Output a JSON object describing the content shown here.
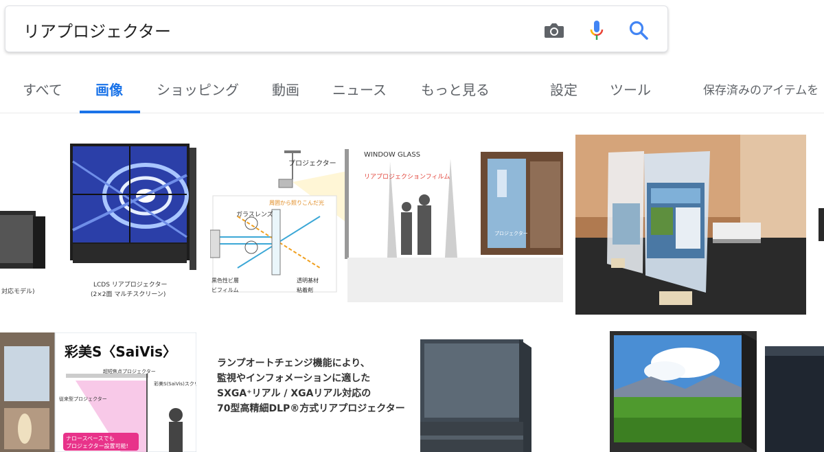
{
  "search": {
    "query": "リアプロジェクター",
    "icons": [
      "camera-icon",
      "microphone-icon",
      "search-icon"
    ]
  },
  "tabs": [
    {
      "label": "すべて",
      "active": false
    },
    {
      "label": "画像",
      "active": true
    },
    {
      "label": "ショッピング",
      "active": false
    },
    {
      "label": "動画",
      "active": false
    },
    {
      "label": "ニュース",
      "active": false
    },
    {
      "label": "もっと見る",
      "active": false
    },
    {
      "label": "設定",
      "active": false
    },
    {
      "label": "ツール",
      "active": false
    },
    {
      "label": "保存済みのアイテムを",
      "active": false
    }
  ],
  "colors": {
    "accent": "#1a73e8",
    "tab_text": "#5f6368",
    "google_blue": "#4285f4",
    "google_red": "#ea4335",
    "google_yellow": "#fbbc04",
    "google_green": "#34a853"
  },
  "results": {
    "t1_caption": "対応モデル)",
    "t2_caption_1": "LCDS リアプロジェクター",
    "t2_caption_2": "(2×2面 マルチスクリーン)",
    "t3": {
      "projector": "プロジェクター",
      "window_glass": "WINDOW GLASS",
      "film": "リアプロジェクションフィルム",
      "light": "周囲から照りこんだ光",
      "glass_lens": "ガラスレンズ",
      "black": "黒色性ビ層",
      "film2": "ビフィルム",
      "transparent": "透明基材",
      "adhesive": "粘着剤",
      "projector2": "プロジェクター"
    },
    "t6": {
      "title": "彩美S〈SaiVis〉",
      "short_focus": "超短焦点プロジェクター",
      "screen": "彩美S(SaiVis)スクリーン",
      "old": "従来型プロジェクター",
      "narrow_1": "ナロースペースでも",
      "narrow_2": "プロジェクター設置可能!"
    },
    "t7": {
      "line1": "ランプオートチェンジ機能により、",
      "line2": "監視やインフォメーションに適した",
      "line3": "SXGA⁺リアル / XGAリアル対応の",
      "line4": "70型高精細DLP®方式リアプロジェクター"
    }
  }
}
